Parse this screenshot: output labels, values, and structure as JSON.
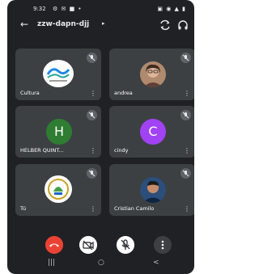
{
  "status_bar": {
    "time": "9:32",
    "left_icons": "⚙ ✉ ■ •",
    "right_icons": "▣ ◉ ▲ ▮"
  },
  "top_bar": {
    "meeting_code": "zzw-dapn-djj",
    "chevron": "▸",
    "back": "←"
  },
  "participants": [
    {
      "name": "Cultura",
      "type": "logo",
      "muted": true
    },
    {
      "name": "andrea",
      "type": "photo",
      "muted": true
    },
    {
      "name": "HELBER QUINT...",
      "type": "initial",
      "initial": "H",
      "color": "#2e7d32",
      "muted": true
    },
    {
      "name": "cindy",
      "type": "initial",
      "initial": "C",
      "color": "#a142f4",
      "muted": true
    },
    {
      "name": "Tú",
      "type": "logo",
      "muted": true
    },
    {
      "name": "Cristian Camilo",
      "type": "photo",
      "muted": true
    }
  ],
  "tile_menu": "⋮",
  "nav": {
    "recents": "|||",
    "home": "○",
    "back": "<"
  },
  "colors": {
    "background": "#202124",
    "tile": "#3c4043",
    "end_call": "#ea4335"
  }
}
